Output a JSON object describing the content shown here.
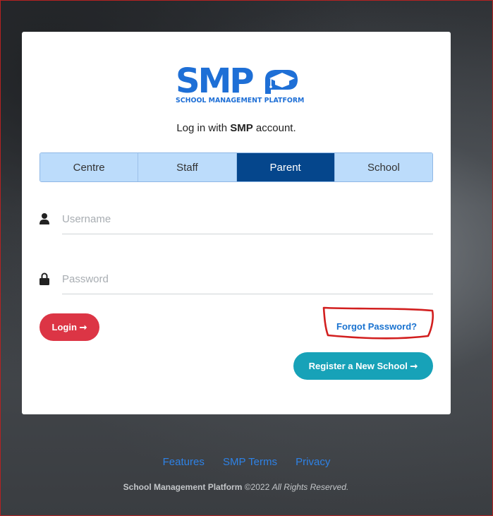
{
  "logo": {
    "mark": "SMP",
    "subtitle": "SCHOOL MANAGEMENT PLATFORM",
    "color": "#1e6fd6"
  },
  "tagline": {
    "prefix": "Log in with",
    "brand": "SMP",
    "suffix": "account."
  },
  "tabs": [
    {
      "label": "Centre",
      "active": false
    },
    {
      "label": "Staff",
      "active": false
    },
    {
      "label": "Parent",
      "active": true
    },
    {
      "label": "School",
      "active": false
    }
  ],
  "form": {
    "username_placeholder": "Username",
    "password_placeholder": "Password",
    "username_value": "",
    "password_value": "",
    "user_icon": "user-icon",
    "lock_icon": "lock-icon"
  },
  "actions": {
    "login_label": "Login ➞",
    "forgot_label": "Forgot Password?",
    "register_label": "Register a New School ➞"
  },
  "footer": {
    "links": [
      "Features",
      "SMP Terms",
      "Privacy"
    ],
    "brand": "School Management Platform",
    "year": "©2022",
    "rights": "All Rights Reserved."
  },
  "colors": {
    "active_tab": "#05468c",
    "inactive_tab": "#bcdcfb",
    "login": "#dc3545",
    "register": "#17a2b8",
    "link": "#1a73d0",
    "annotation": "#d21f1f"
  }
}
